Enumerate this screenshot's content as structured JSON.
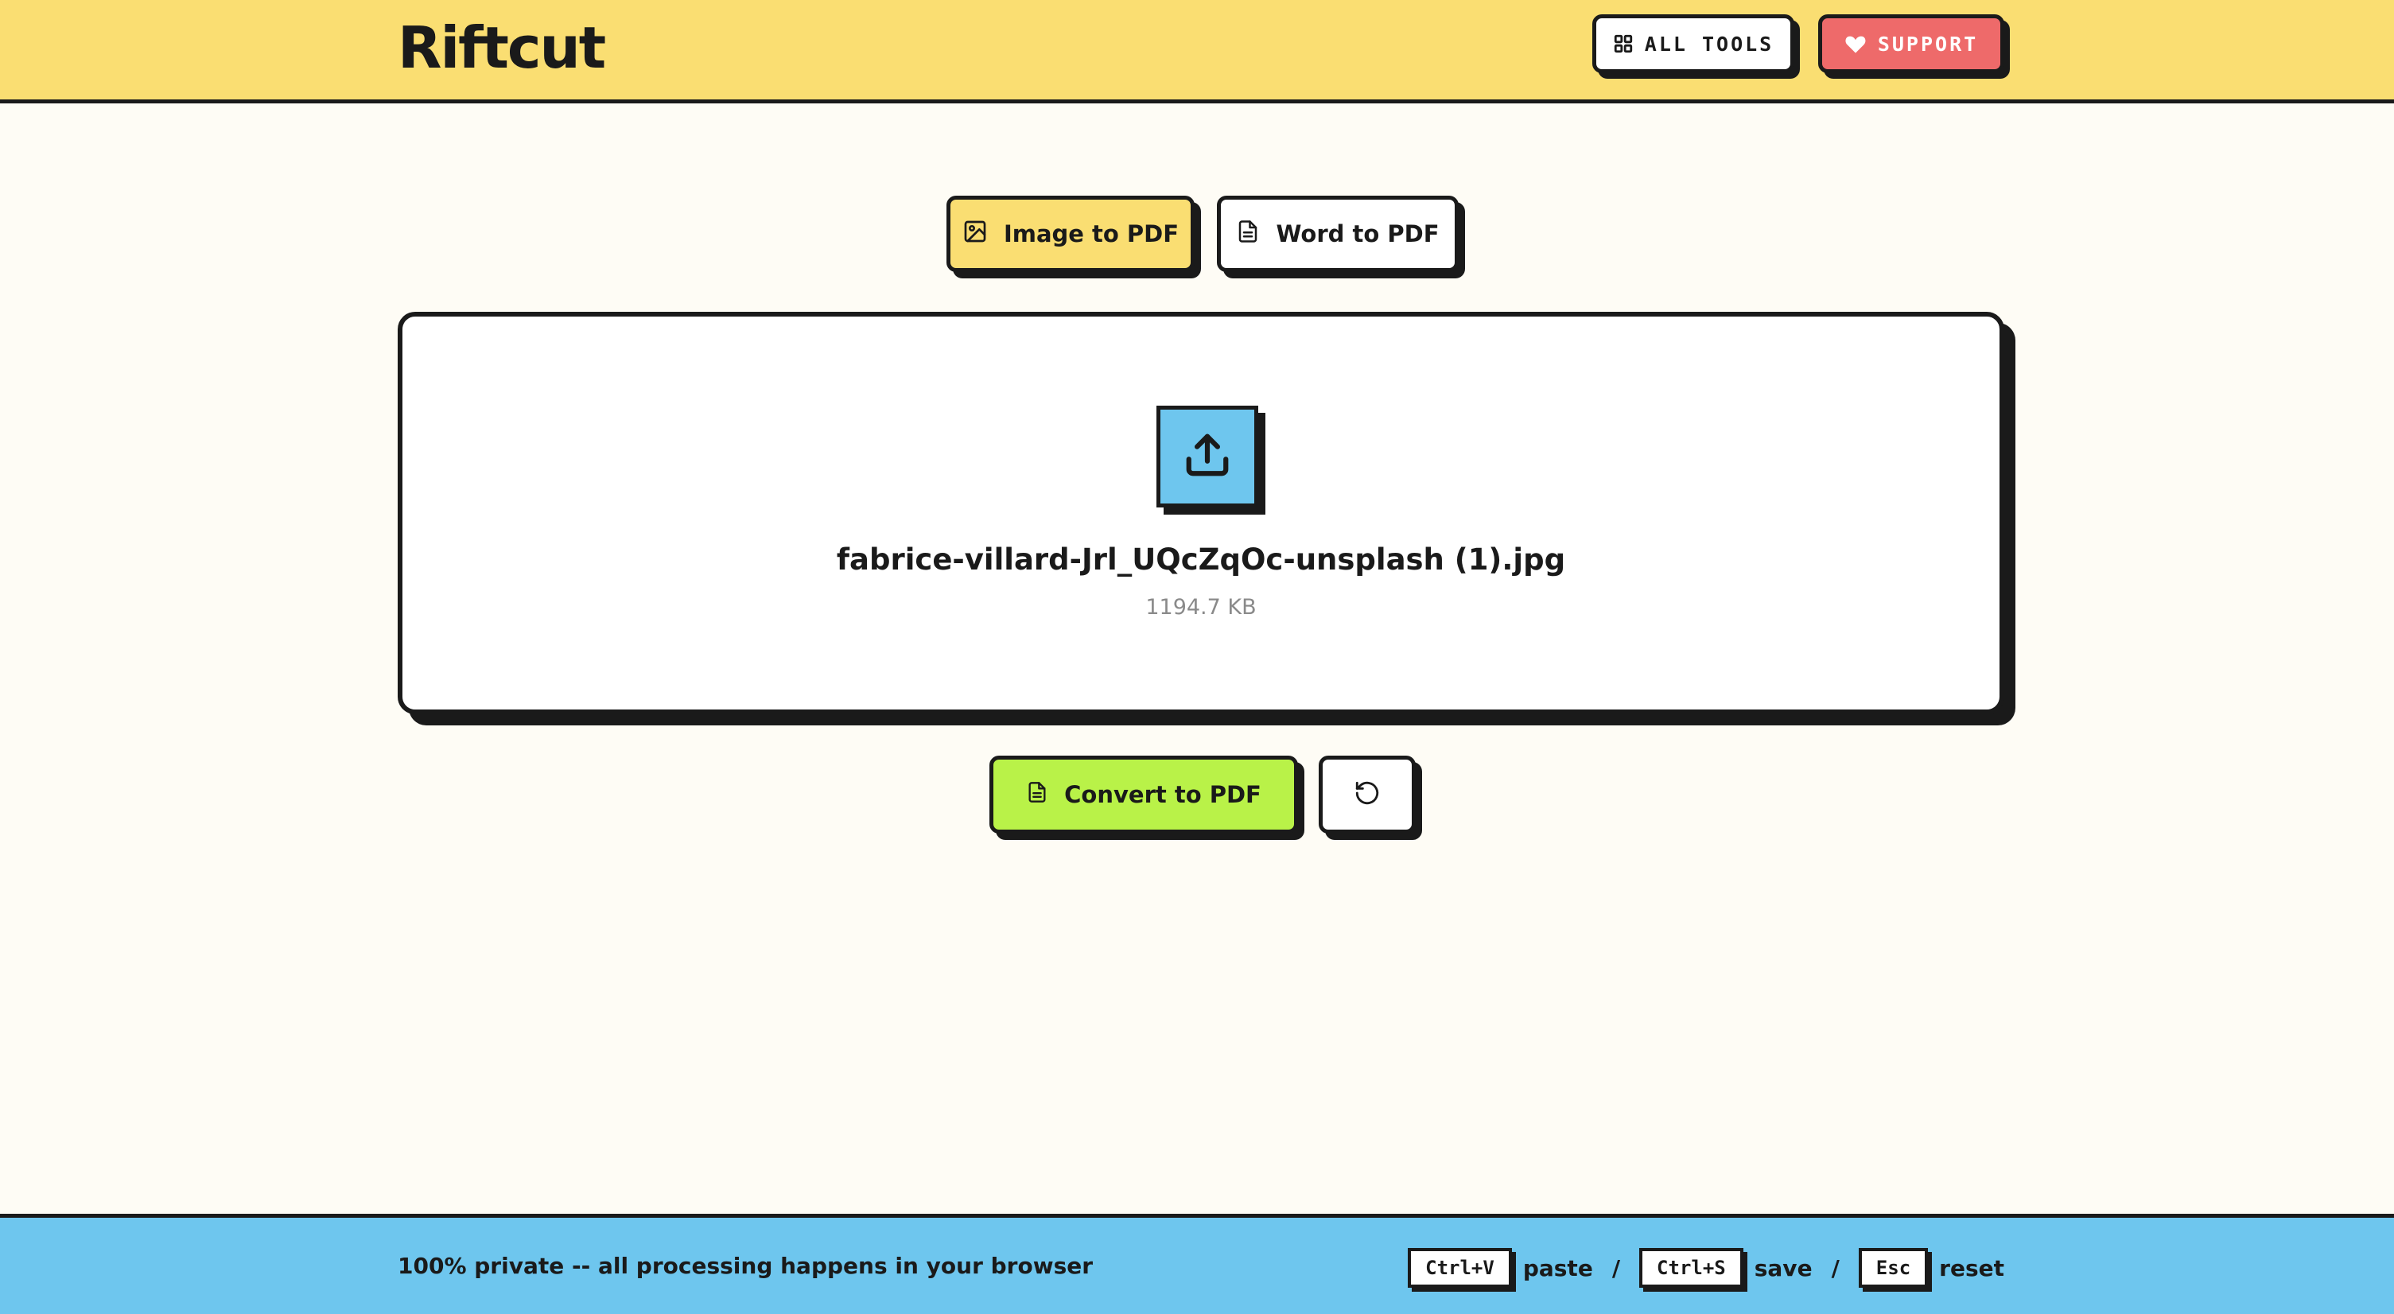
{
  "header": {
    "logo": "Riftcut",
    "all_tools_label": "ALL TOOLS",
    "all_tools_icon": "grid-icon",
    "support_label": "SUPPORT",
    "support_icon": "heart-icon"
  },
  "tabs": [
    {
      "label": "Image to PDF",
      "icon": "image-icon",
      "active": true
    },
    {
      "label": "Word to PDF",
      "icon": "document-icon",
      "active": false
    }
  ],
  "dropzone": {
    "icon": "upload-icon",
    "file_name": "fabrice-villard-Jrl_UQcZqOc-unsplash (1).jpg",
    "file_size": "1194.7 KB"
  },
  "actions": {
    "convert_label": "Convert to PDF",
    "convert_icon": "document-icon",
    "reset_icon": "reset-icon"
  },
  "footer": {
    "privacy_text": "100% private -- all processing happens in your browser",
    "shortcuts": [
      {
        "key": "Ctrl+V",
        "action": "paste"
      },
      {
        "key": "Ctrl+S",
        "action": "save"
      },
      {
        "key": "Esc",
        "action": "reset"
      }
    ],
    "separator": "/"
  },
  "colors": {
    "header_bg": "#fade72",
    "page_bg": "#fefcf5",
    "footer_bg": "#6ec6ee",
    "support_bg": "#ee6a6a",
    "convert_bg": "#b9f248",
    "upload_bg": "#6ec6ee",
    "border": "#1a1a1a"
  }
}
